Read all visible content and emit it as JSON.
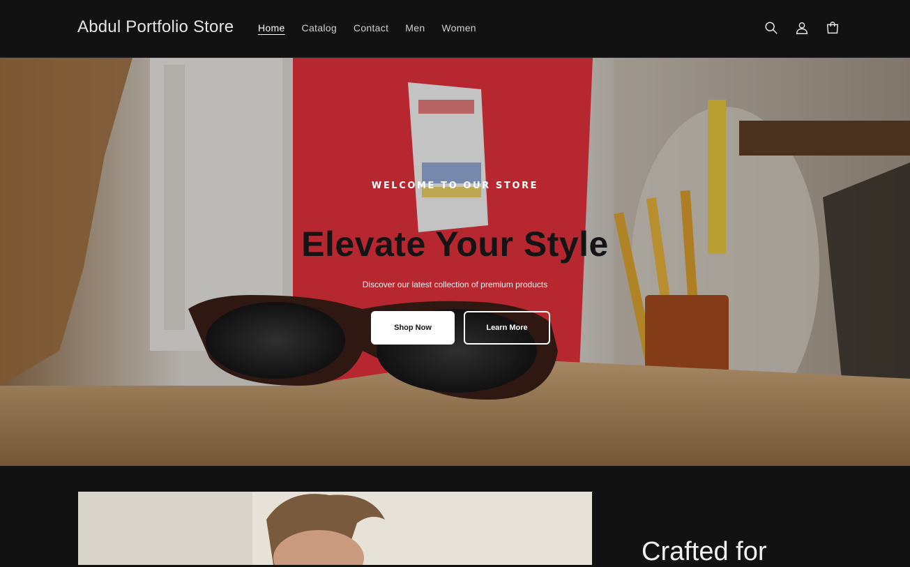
{
  "header": {
    "store_name": "Abdul Portfolio Store",
    "nav": [
      {
        "label": "Home",
        "active": true
      },
      {
        "label": "Catalog",
        "active": false
      },
      {
        "label": "Contact",
        "active": false
      },
      {
        "label": "Men",
        "active": false
      },
      {
        "label": "Women",
        "active": false
      }
    ],
    "icons": [
      "search-icon",
      "account-icon",
      "cart-icon"
    ]
  },
  "hero": {
    "eyebrow": "WELCOME TO OUR STORE",
    "title": "Elevate Your Style",
    "subtitle": "Discover our latest collection of premium products",
    "primary_button": "Shop Now",
    "secondary_button": "Learn More"
  },
  "feature": {
    "title": "Crafted for"
  },
  "colors": {
    "background": "#121212",
    "text": "#ffffff",
    "hero_title": "#141414"
  }
}
